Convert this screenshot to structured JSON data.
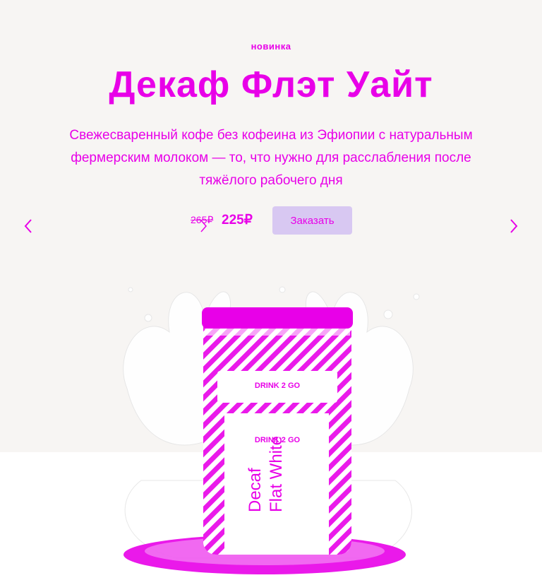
{
  "hero": {
    "eyebrow": "новинка",
    "title": "Декаф Флэт Уайт",
    "description": "Свежесваренный кофе без кофеина из Эфиопии с натуральным фермерским молоком — то, что нужно для расслабления после тяжёлого рабочего дня",
    "old_price": "265₽",
    "price": "225₽",
    "order_label": "Заказать"
  },
  "product": {
    "brand_top": "DRINK 2 GO",
    "brand_label": "DRINK 2 GO",
    "name_line1": "Decaf",
    "name_line2": "Flat White"
  },
  "colors": {
    "accent": "#e800e8",
    "button_bg": "#d8c8f2",
    "hero_bg": "#f7f5f3"
  },
  "icons": {
    "prev": "chevron-left-icon",
    "next": "chevron-right-icon"
  }
}
